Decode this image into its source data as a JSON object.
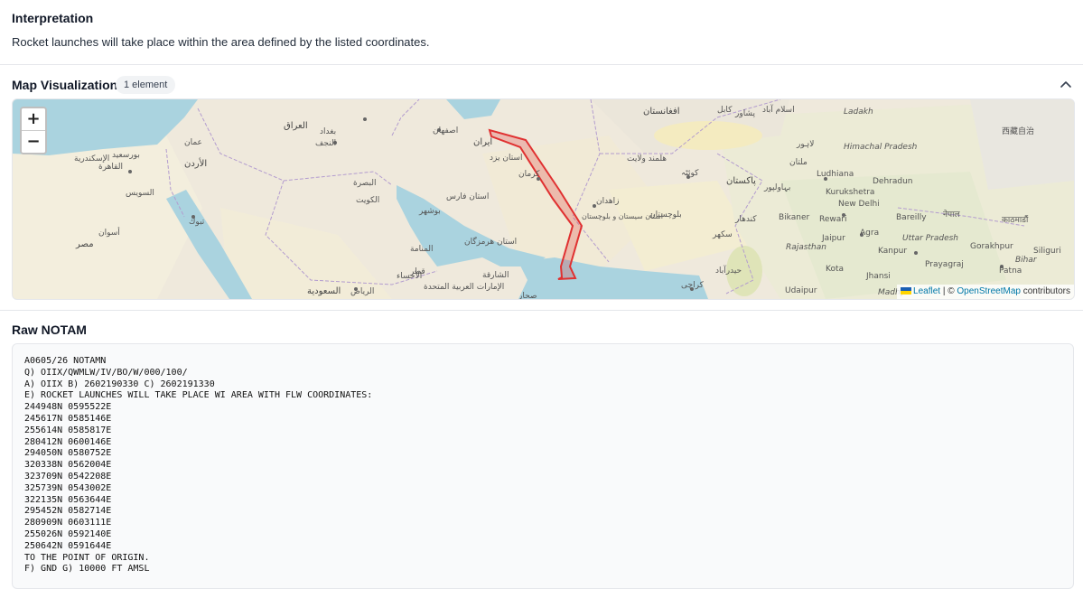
{
  "interpretation": {
    "heading": "Interpretation",
    "text": "Rocket launches will take place within the area defined by the listed coordinates."
  },
  "map_section": {
    "heading": "Map Visualization",
    "badge": "1 element",
    "zoom_in": "+",
    "zoom_out": "−",
    "attribution": {
      "leaflet": "Leaflet",
      "separator": " | © ",
      "osm": "OpenStreetMap",
      "suffix": " contributors"
    },
    "polygon_color": "#e03131",
    "labels": {
      "iran": "ایران",
      "afghanistan": "افغانستان",
      "pakistan": "پاکستان",
      "iraq": "العراق",
      "kuwait": "الكويت",
      "uae": "الإمارات العربية المتحدة",
      "saudi": "السعودية",
      "riyadh": "الرياض",
      "cairo": "القاهرة",
      "egypt": "مصر",
      "baghdad": "بغداد",
      "isfahan": "اصفهان",
      "kerman": "كرمان",
      "zahedan": "زاهدان",
      "quetta": "کوئٹہ",
      "karachi": "کراچی",
      "kabul": "کابل",
      "lahore": "لاہور",
      "ludhiana": "Ludhiana",
      "dehradun": "Dehradun",
      "kurukshetra": "Kurukshetra",
      "new_delhi": "New Delhi",
      "bareilly": "Bareilly",
      "bikaner": "Bikaner",
      "rewari": "Rewari",
      "jaipur": "Jaipur",
      "agra": "Agra",
      "kanpur": "Kanpur",
      "prayagraj": "Prayagraj",
      "patna": "Patna",
      "gorakhpur": "Gorakhpur",
      "siliguri": "Siliguri",
      "kota": "Kota",
      "jhansi": "Jhansi",
      "udaipur": "Udaipur",
      "rajasthan": "Rajasthan",
      "uttar_pradesh": "Uttar Pradesh",
      "bihar": "Bihar",
      "himachal": "Himachal Pradesh",
      "ladakh": "Ladakh",
      "madhya": "Madhya",
      "doha": "قطر",
      "manama": "المنامة",
      "bushehr": "بوشهر",
      "sharjah": "الشارقة",
      "tabuk": "تبوك",
      "aswan": "أسوان",
      "amman": "عمان",
      "jordan": "الأردن",
      "alexandria": "الإسكندرية",
      "port_said": "بورسعيد",
      "suez": "السويس",
      "basra": "البصرة",
      "najaf": "النجف",
      "yazd": "استان یزد",
      "hormozgan": "استان هرمزگان",
      "fars": "استان فارس",
      "sistan": "استان سیستان و بلوچستان",
      "balochistan": "بلوچستان",
      "multan": "ملتان",
      "bahawalpur": "بہاولپور",
      "sukkur": "سکھر",
      "hyderabad": "حیدرآباد",
      "ahsa": "الأحساء",
      "dubai": "صحار",
      "nepal": "नेपाल",
      "kathmandu": "काठमाडौं",
      "tibet": "西藏自治",
      "islamabad": "اسلام آباد",
      "peshawar": "پشاور",
      "kandahar": "کندھار",
      "helmand": "هلمند ولایت"
    }
  },
  "raw_notam": {
    "heading": "Raw NOTAM",
    "lines": [
      "A0605/26 NOTAMN",
      "Q) OIIX/QWMLW/IV/BO/W/000/100/",
      "A) OIIX B) 2602190330 C) 2602191330",
      "E) ROCKET LAUNCHES WILL TAKE PLACE WI AREA WITH FLW COORDINATES:",
      "244948N 0595522E",
      "245617N 0585146E",
      "255614N 0585817E",
      "280412N 0600146E",
      "294050N 0580752E",
      "320338N 0562004E",
      "323709N 0542208E",
      "325739N 0543002E",
      "322135N 0563644E",
      "295452N 0582714E",
      "280909N 0603111E",
      "255026N 0592140E",
      "250642N 0591644E",
      "TO THE POINT OF ORIGIN.",
      "F) GND G) 10000 FT AMSL"
    ]
  }
}
